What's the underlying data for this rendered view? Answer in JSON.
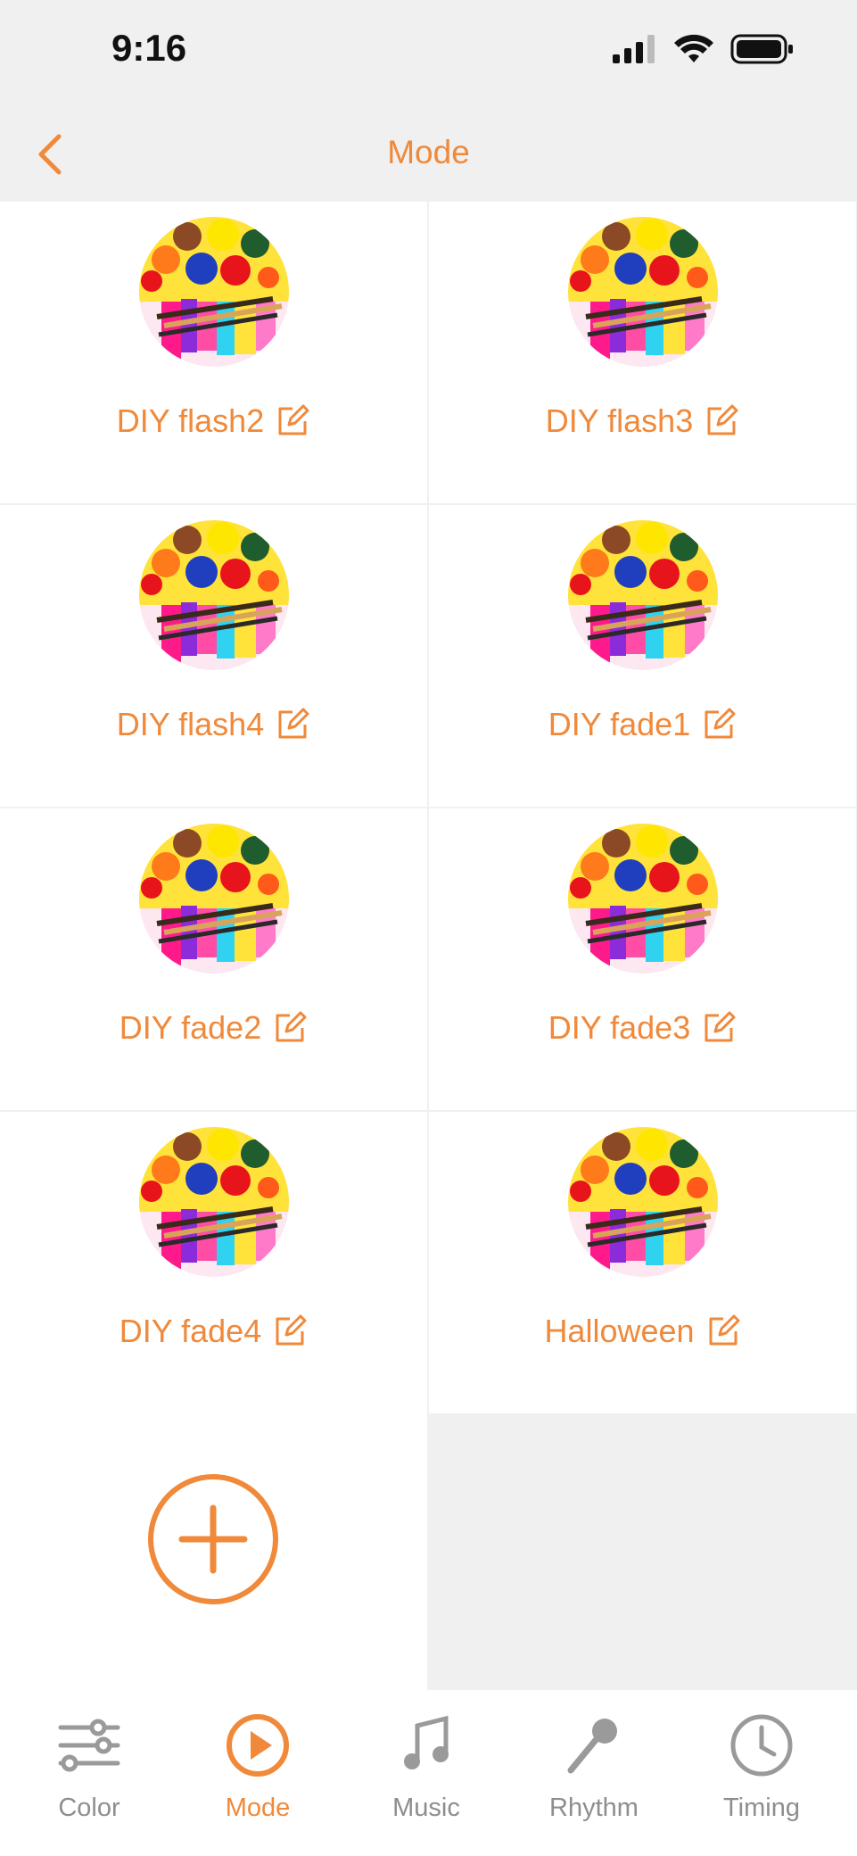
{
  "status": {
    "time": "9:16"
  },
  "nav": {
    "title": "Mode"
  },
  "modes": [
    {
      "label": "DIY flash2"
    },
    {
      "label": "DIY flash3"
    },
    {
      "label": "DIY flash4"
    },
    {
      "label": "DIY fade1"
    },
    {
      "label": "DIY fade2"
    },
    {
      "label": "DIY fade3"
    },
    {
      "label": "DIY fade4"
    },
    {
      "label": "Halloween"
    }
  ],
  "tabs": [
    {
      "label": "Color",
      "icon": "sliders-icon",
      "active": false
    },
    {
      "label": "Mode",
      "icon": "play-circle-icon",
      "active": true
    },
    {
      "label": "Music",
      "icon": "music-note-icon",
      "active": false
    },
    {
      "label": "Rhythm",
      "icon": "microphone-icon",
      "active": false
    },
    {
      "label": "Timing",
      "icon": "clock-icon",
      "active": false
    }
  ],
  "colors": {
    "accent": "#f0893a",
    "inactive": "#8e8e8e",
    "background": "#f0f0f0"
  }
}
